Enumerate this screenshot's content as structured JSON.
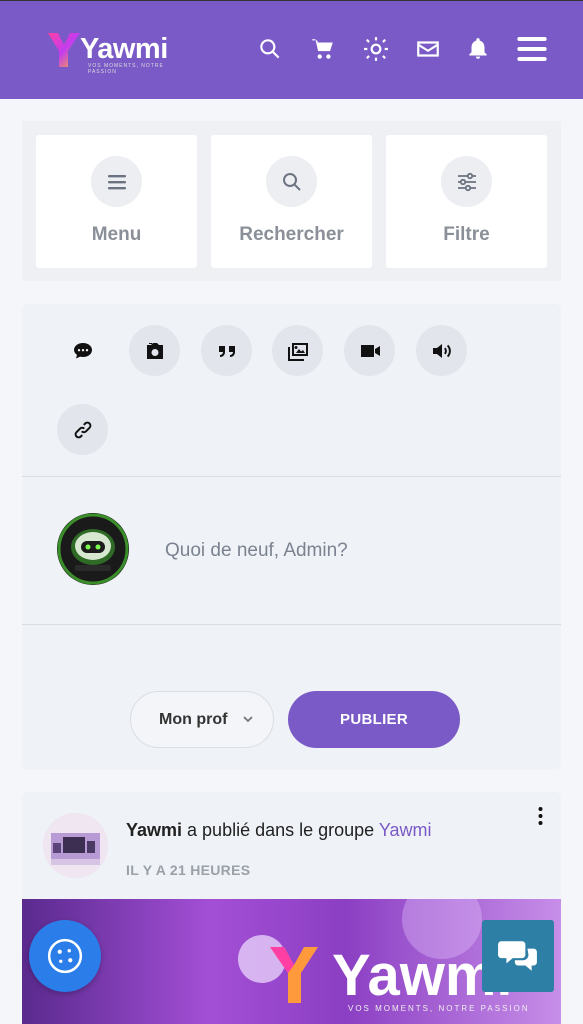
{
  "brand": {
    "name": "Yawmi",
    "tagline": "VOS MOMENTS, NOTRE PASSION"
  },
  "header": {
    "icons": [
      "search-icon",
      "cart-icon",
      "sun-icon",
      "mail-icon",
      "bell-icon",
      "hamburger-icon"
    ]
  },
  "quick": {
    "menu_label": "Menu",
    "search_label": "Rechercher",
    "filter_label": "Filtre"
  },
  "composer": {
    "post_types": [
      "chat-icon",
      "camera-icon",
      "quote-icon",
      "images-icon",
      "video-icon",
      "audio-icon",
      "link-icon"
    ],
    "placeholder": "Quoi de neuf, Admin?",
    "audience_label": "Mon prof",
    "publish_label": "PUBLIER"
  },
  "post": {
    "author": "Yawmi",
    "action": " a publié dans le groupe ",
    "group": "Yawmi",
    "time": "IL Y A 21 HEURES",
    "image_text": "Yawmi",
    "image_subtext": "VOS MOMENTS, NOTRE PASSION"
  },
  "colors": {
    "brand": "#7a5ac6",
    "fab_blue": "#2b7de9",
    "chat_teal": "#2e7fa5"
  }
}
